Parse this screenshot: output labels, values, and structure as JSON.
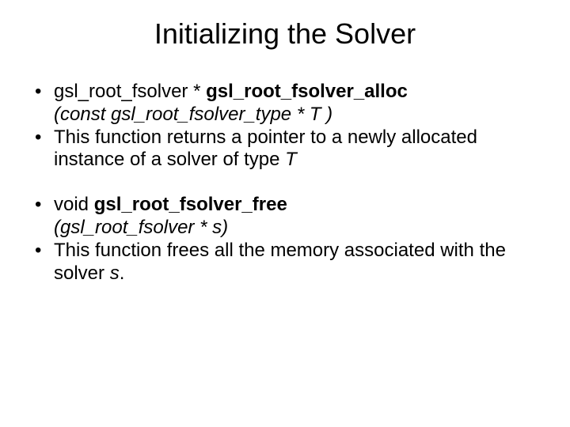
{
  "title": "Initializing the Solver",
  "bullets": {
    "b1": {
      "prefix": "gsl_root_fsolver * ",
      "fn": "gsl_root_fsolver_alloc",
      "sig": "(const gsl_root_fsolver_type * T )"
    },
    "b2": {
      "text_a": "This function returns a pointer to a newly allocated instance of a solver of type ",
      "param": "T"
    },
    "b3": {
      "prefix": "void ",
      "fn": "gsl_root_fsolver_free",
      "sig": "(gsl_root_fsolver * s)"
    },
    "b4": {
      "text_a": "This function frees all the memory associated with the solver ",
      "param": "s",
      "text_b": "."
    }
  },
  "dot": "•"
}
